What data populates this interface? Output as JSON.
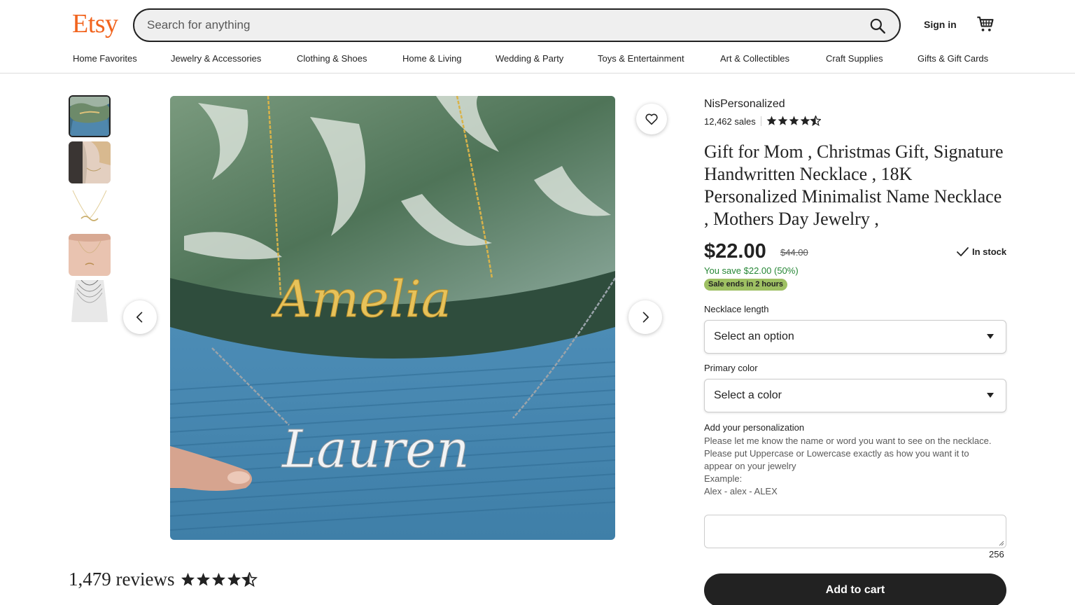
{
  "header": {
    "logo": "Etsy",
    "search_placeholder": "Search for anything",
    "signin_label": "Sign in",
    "search_icon": "search-icon",
    "cart_icon": "cart-icon"
  },
  "nav": {
    "items": [
      "Home Favorites",
      "Jewelry & Accessories",
      "Clothing & Shoes",
      "Home & Living",
      "Wedding & Party",
      "Toys & Entertainment",
      "Art & Collectibles",
      "Craft Supplies",
      "Gifts & Gift Cards"
    ]
  },
  "gallery": {
    "thumbnail_count": 5,
    "active_thumbnail": 1,
    "main_image_text": [
      "Amelia",
      "Lauren"
    ],
    "icons": [
      "heart-icon",
      "chevron-left-icon",
      "chevron-right-icon"
    ]
  },
  "reviews": {
    "title": "1,479 reviews",
    "rating": 4.5
  },
  "listing": {
    "shop_name": "NisPersonalized",
    "sales": "12,462 sales",
    "shop_rating": 4.5,
    "title": "Gift for Mom , Christmas Gift, Signature Handwritten Necklace , 18K Personalized Minimalist Name Necklace , Mothers Day Jewelry ,",
    "price": "$22.00",
    "original_price": "$44.00",
    "stock": "In stock",
    "savings": "You save $22.00 (50%)",
    "sale_badge": "Sale ends in 2 hours",
    "necklace_length_label": "Necklace length",
    "necklace_length_value": "Select an option",
    "color_label": "Primary color",
    "color_value": "Select a color",
    "personalization_label": "Add your personalization",
    "personalization_instructions": [
      "Please let me know the name or word you want to see on the necklace.",
      "Please put Uppercase or Lowercase exactly as how you want it to appear on your jewelry",
      "Example:",
      "Alex - alex - ALEX"
    ],
    "char_count": "256",
    "add_to_cart": "Add to cart"
  },
  "colors": {
    "brand": "#F1641E",
    "savings": "#258635",
    "sale_badge": "#9EC063",
    "button": "#222222"
  }
}
